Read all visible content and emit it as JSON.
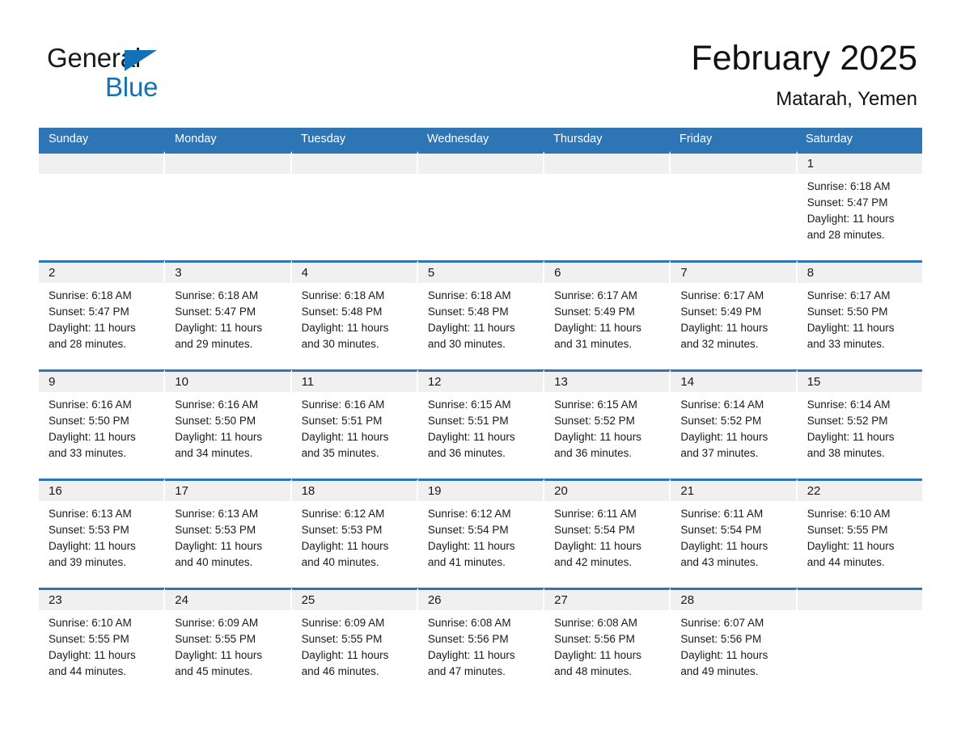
{
  "brand": {
    "name_part1": "General",
    "name_part2": "Blue",
    "triangle_icon": "brand-triangle-icon",
    "accent_color": "#1371b8"
  },
  "header": {
    "title": "February 2025",
    "subtitle": "Matarah, Yemen",
    "table_header_color": "#2e75b6",
    "date_band_color": "#f0f0f0"
  },
  "weekday_headers": [
    "Sunday",
    "Monday",
    "Tuesday",
    "Wednesday",
    "Thursday",
    "Friday",
    "Saturday"
  ],
  "weeks": [
    {
      "days": [
        {
          "date": "",
          "sunrise": "",
          "sunset": "",
          "daylight_line1": "",
          "daylight_line2": "",
          "empty": true
        },
        {
          "date": "",
          "sunrise": "",
          "sunset": "",
          "daylight_line1": "",
          "daylight_line2": "",
          "empty": true
        },
        {
          "date": "",
          "sunrise": "",
          "sunset": "",
          "daylight_line1": "",
          "daylight_line2": "",
          "empty": true
        },
        {
          "date": "",
          "sunrise": "",
          "sunset": "",
          "daylight_line1": "",
          "daylight_line2": "",
          "empty": true
        },
        {
          "date": "",
          "sunrise": "",
          "sunset": "",
          "daylight_line1": "",
          "daylight_line2": "",
          "empty": true
        },
        {
          "date": "",
          "sunrise": "",
          "sunset": "",
          "daylight_line1": "",
          "daylight_line2": "",
          "empty": true
        },
        {
          "date": "1",
          "sunrise": "Sunrise: 6:18 AM",
          "sunset": "Sunset: 5:47 PM",
          "daylight_line1": "Daylight: 11 hours",
          "daylight_line2": "and 28 minutes.",
          "empty": false
        }
      ]
    },
    {
      "days": [
        {
          "date": "2",
          "sunrise": "Sunrise: 6:18 AM",
          "sunset": "Sunset: 5:47 PM",
          "daylight_line1": "Daylight: 11 hours",
          "daylight_line2": "and 28 minutes.",
          "empty": false
        },
        {
          "date": "3",
          "sunrise": "Sunrise: 6:18 AM",
          "sunset": "Sunset: 5:47 PM",
          "daylight_line1": "Daylight: 11 hours",
          "daylight_line2": "and 29 minutes.",
          "empty": false
        },
        {
          "date": "4",
          "sunrise": "Sunrise: 6:18 AM",
          "sunset": "Sunset: 5:48 PM",
          "daylight_line1": "Daylight: 11 hours",
          "daylight_line2": "and 30 minutes.",
          "empty": false
        },
        {
          "date": "5",
          "sunrise": "Sunrise: 6:18 AM",
          "sunset": "Sunset: 5:48 PM",
          "daylight_line1": "Daylight: 11 hours",
          "daylight_line2": "and 30 minutes.",
          "empty": false
        },
        {
          "date": "6",
          "sunrise": "Sunrise: 6:17 AM",
          "sunset": "Sunset: 5:49 PM",
          "daylight_line1": "Daylight: 11 hours",
          "daylight_line2": "and 31 minutes.",
          "empty": false
        },
        {
          "date": "7",
          "sunrise": "Sunrise: 6:17 AM",
          "sunset": "Sunset: 5:49 PM",
          "daylight_line1": "Daylight: 11 hours",
          "daylight_line2": "and 32 minutes.",
          "empty": false
        },
        {
          "date": "8",
          "sunrise": "Sunrise: 6:17 AM",
          "sunset": "Sunset: 5:50 PM",
          "daylight_line1": "Daylight: 11 hours",
          "daylight_line2": "and 33 minutes.",
          "empty": false
        }
      ]
    },
    {
      "days": [
        {
          "date": "9",
          "sunrise": "Sunrise: 6:16 AM",
          "sunset": "Sunset: 5:50 PM",
          "daylight_line1": "Daylight: 11 hours",
          "daylight_line2": "and 33 minutes.",
          "empty": false
        },
        {
          "date": "10",
          "sunrise": "Sunrise: 6:16 AM",
          "sunset": "Sunset: 5:50 PM",
          "daylight_line1": "Daylight: 11 hours",
          "daylight_line2": "and 34 minutes.",
          "empty": false
        },
        {
          "date": "11",
          "sunrise": "Sunrise: 6:16 AM",
          "sunset": "Sunset: 5:51 PM",
          "daylight_line1": "Daylight: 11 hours",
          "daylight_line2": "and 35 minutes.",
          "empty": false
        },
        {
          "date": "12",
          "sunrise": "Sunrise: 6:15 AM",
          "sunset": "Sunset: 5:51 PM",
          "daylight_line1": "Daylight: 11 hours",
          "daylight_line2": "and 36 minutes.",
          "empty": false
        },
        {
          "date": "13",
          "sunrise": "Sunrise: 6:15 AM",
          "sunset": "Sunset: 5:52 PM",
          "daylight_line1": "Daylight: 11 hours",
          "daylight_line2": "and 36 minutes.",
          "empty": false
        },
        {
          "date": "14",
          "sunrise": "Sunrise: 6:14 AM",
          "sunset": "Sunset: 5:52 PM",
          "daylight_line1": "Daylight: 11 hours",
          "daylight_line2": "and 37 minutes.",
          "empty": false
        },
        {
          "date": "15",
          "sunrise": "Sunrise: 6:14 AM",
          "sunset": "Sunset: 5:52 PM",
          "daylight_line1": "Daylight: 11 hours",
          "daylight_line2": "and 38 minutes.",
          "empty": false
        }
      ]
    },
    {
      "days": [
        {
          "date": "16",
          "sunrise": "Sunrise: 6:13 AM",
          "sunset": "Sunset: 5:53 PM",
          "daylight_line1": "Daylight: 11 hours",
          "daylight_line2": "and 39 minutes.",
          "empty": false
        },
        {
          "date": "17",
          "sunrise": "Sunrise: 6:13 AM",
          "sunset": "Sunset: 5:53 PM",
          "daylight_line1": "Daylight: 11 hours",
          "daylight_line2": "and 40 minutes.",
          "empty": false
        },
        {
          "date": "18",
          "sunrise": "Sunrise: 6:12 AM",
          "sunset": "Sunset: 5:53 PM",
          "daylight_line1": "Daylight: 11 hours",
          "daylight_line2": "and 40 minutes.",
          "empty": false
        },
        {
          "date": "19",
          "sunrise": "Sunrise: 6:12 AM",
          "sunset": "Sunset: 5:54 PM",
          "daylight_line1": "Daylight: 11 hours",
          "daylight_line2": "and 41 minutes.",
          "empty": false
        },
        {
          "date": "20",
          "sunrise": "Sunrise: 6:11 AM",
          "sunset": "Sunset: 5:54 PM",
          "daylight_line1": "Daylight: 11 hours",
          "daylight_line2": "and 42 minutes.",
          "empty": false
        },
        {
          "date": "21",
          "sunrise": "Sunrise: 6:11 AM",
          "sunset": "Sunset: 5:54 PM",
          "daylight_line1": "Daylight: 11 hours",
          "daylight_line2": "and 43 minutes.",
          "empty": false
        },
        {
          "date": "22",
          "sunrise": "Sunrise: 6:10 AM",
          "sunset": "Sunset: 5:55 PM",
          "daylight_line1": "Daylight: 11 hours",
          "daylight_line2": "and 44 minutes.",
          "empty": false
        }
      ]
    },
    {
      "days": [
        {
          "date": "23",
          "sunrise": "Sunrise: 6:10 AM",
          "sunset": "Sunset: 5:55 PM",
          "daylight_line1": "Daylight: 11 hours",
          "daylight_line2": "and 44 minutes.",
          "empty": false
        },
        {
          "date": "24",
          "sunrise": "Sunrise: 6:09 AM",
          "sunset": "Sunset: 5:55 PM",
          "daylight_line1": "Daylight: 11 hours",
          "daylight_line2": "and 45 minutes.",
          "empty": false
        },
        {
          "date": "25",
          "sunrise": "Sunrise: 6:09 AM",
          "sunset": "Sunset: 5:55 PM",
          "daylight_line1": "Daylight: 11 hours",
          "daylight_line2": "and 46 minutes.",
          "empty": false
        },
        {
          "date": "26",
          "sunrise": "Sunrise: 6:08 AM",
          "sunset": "Sunset: 5:56 PM",
          "daylight_line1": "Daylight: 11 hours",
          "daylight_line2": "and 47 minutes.",
          "empty": false
        },
        {
          "date": "27",
          "sunrise": "Sunrise: 6:08 AM",
          "sunset": "Sunset: 5:56 PM",
          "daylight_line1": "Daylight: 11 hours",
          "daylight_line2": "and 48 minutes.",
          "empty": false
        },
        {
          "date": "28",
          "sunrise": "Sunrise: 6:07 AM",
          "sunset": "Sunset: 5:56 PM",
          "daylight_line1": "Daylight: 11 hours",
          "daylight_line2": "and 49 minutes.",
          "empty": false
        },
        {
          "date": "",
          "sunrise": "",
          "sunset": "",
          "daylight_line1": "",
          "daylight_line2": "",
          "empty": true
        }
      ]
    }
  ]
}
